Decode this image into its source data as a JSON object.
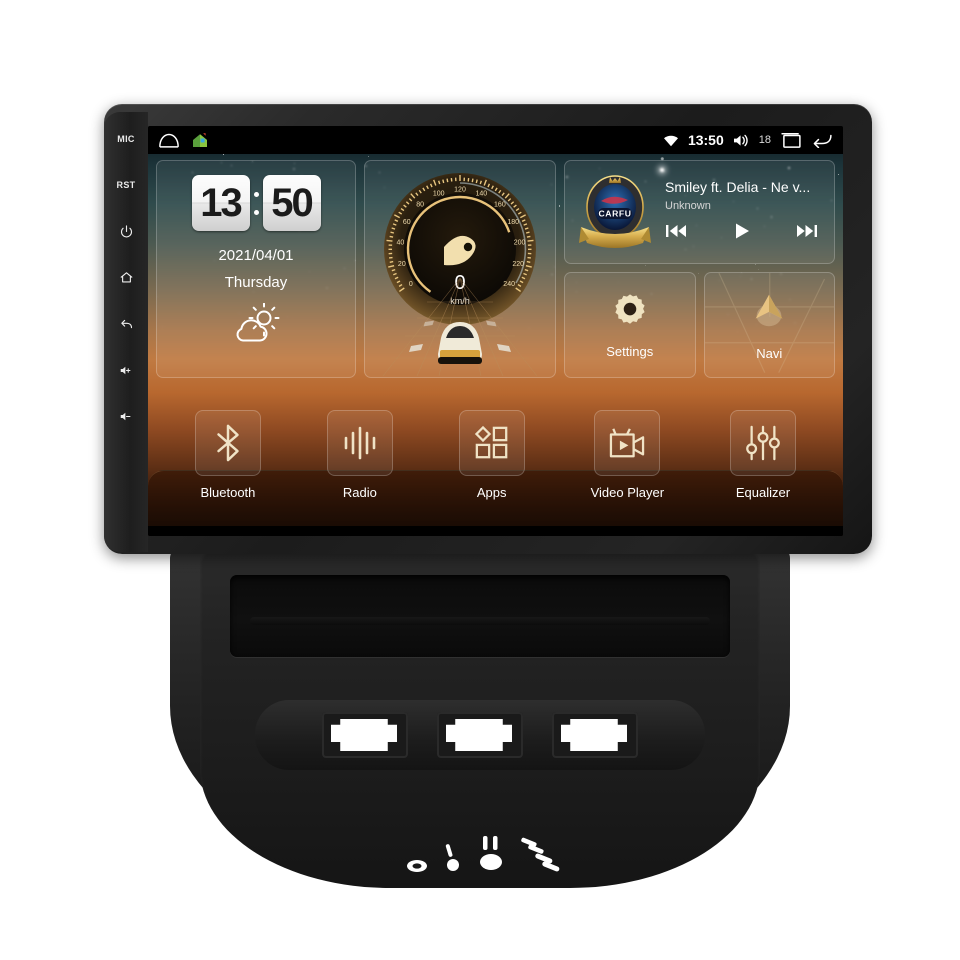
{
  "device": {
    "name": "android-car-head-unit",
    "side_buttons": [
      {
        "id": "mic",
        "label": "MIC",
        "type": "text"
      },
      {
        "id": "reset",
        "label": "RST",
        "type": "text"
      },
      {
        "id": "power",
        "label": "power-icon",
        "type": "icon"
      },
      {
        "id": "home",
        "label": "home-icon",
        "type": "icon"
      },
      {
        "id": "back",
        "label": "back-icon",
        "type": "icon"
      },
      {
        "id": "vol-up",
        "label": "volume-up-icon",
        "type": "icon"
      },
      {
        "id": "vol-down",
        "label": "volume-down-icon",
        "type": "icon"
      }
    ]
  },
  "statusbar": {
    "left_icons": [
      "home-outline-icon",
      "green-house-app-icon"
    ],
    "wifi_icon": "wifi-icon",
    "time": "13:50",
    "volume_icon": "volume-icon",
    "volume_level": "18",
    "recents_icon": "recents-icon",
    "back_icon": "back-arrow-icon"
  },
  "clock_widget": {
    "hours": "13",
    "minutes": "50",
    "date": "2021/04/01",
    "weekday": "Thursday",
    "weather_icon": "partly-cloudy-icon"
  },
  "speedometer_widget": {
    "value": "0",
    "unit": "km/h",
    "ticks": [
      "0",
      "20",
      "40",
      "60",
      "80",
      "100",
      "120",
      "140",
      "160",
      "180",
      "200",
      "220",
      "240"
    ],
    "max": 240,
    "pointer_icon": "speed-pointer-icon",
    "scene_icon": "car-on-road-icon"
  },
  "media_widget": {
    "album_art_text": "CARFU",
    "track": "Smiley ft. Delia - Ne v...",
    "artist": "Unknown",
    "controls": [
      {
        "name": "previous-track-button",
        "icon": "prev-icon"
      },
      {
        "name": "play-button",
        "icon": "play-icon"
      },
      {
        "name": "next-track-button",
        "icon": "next-icon"
      }
    ]
  },
  "tiles": [
    {
      "name": "settings-tile",
      "label": "Settings",
      "icon": "gear-icon"
    },
    {
      "name": "navi-tile",
      "label": "Navi",
      "icon": "navigation-arrow-icon"
    }
  ],
  "dock": [
    {
      "name": "bluetooth-app",
      "label": "Bluetooth",
      "icon": "bluetooth-icon"
    },
    {
      "name": "radio-app",
      "label": "Radio",
      "icon": "radio-waves-icon"
    },
    {
      "name": "apps-app",
      "label": "Apps",
      "icon": "apps-grid-icon"
    },
    {
      "name": "video-player-app",
      "label": "Video Player",
      "icon": "video-camera-icon"
    },
    {
      "name": "equalizer-app",
      "label": "Equalizer",
      "icon": "equalizer-sliders-icon"
    }
  ],
  "colors": {
    "accent_gold": "#d9b36a",
    "screen_top": "#1b3238",
    "screen_bottom": "#8f4a22",
    "bezel": "#222222",
    "text": "#ffffff"
  },
  "fascia": {
    "name": "dashboard-fascia-panel",
    "tray": "storage-tray",
    "switch_cutouts": 3,
    "hvac_marking": "fan-speed-dial-markings"
  }
}
